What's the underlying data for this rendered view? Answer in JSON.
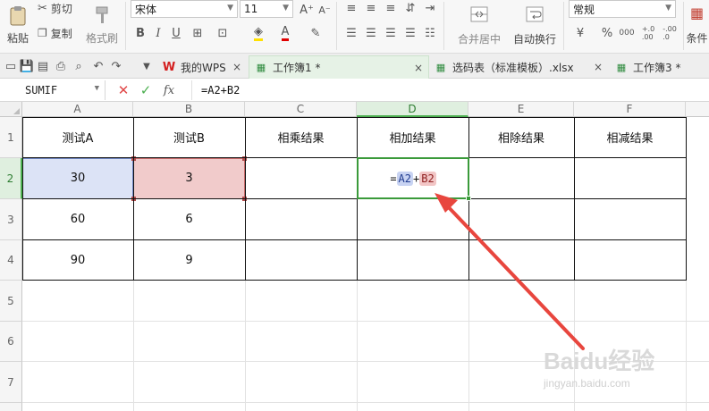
{
  "ribbon": {
    "paste_label": "粘贴",
    "cut_label": "剪切",
    "copy_label": "复制",
    "format_painter_label": "格式刷",
    "font_name": "宋体",
    "font_size": "11",
    "merge_center_label": "合并居中",
    "wrap_text_label": "自动换行",
    "number_format": "常规",
    "conditional_label": "条件",
    "bold": "B",
    "italic": "I",
    "underline": "U",
    "font_color_letter": "A",
    "increase_font": "A⁺",
    "decrease_font": "A⁻",
    "percent": "%",
    "thousands": "000",
    "inc_decimal": "+.0\n.00",
    "dec_decimal": "-.00\n.0"
  },
  "tabs": [
    {
      "label": "我的WPS",
      "icon": "wps-logo-icon"
    },
    {
      "label": "工作簿1 *",
      "icon": "spreadsheet-icon"
    },
    {
      "label": "选码表（标准模板）.xlsx",
      "icon": "spreadsheet-icon"
    },
    {
      "label": "工作簿3 *",
      "icon": "spreadsheet-icon"
    }
  ],
  "formula_bar": {
    "name_box": "SUMIF",
    "fx_label": "fx",
    "formula": "=A2+B2"
  },
  "grid": {
    "columns": [
      "A",
      "B",
      "C",
      "D",
      "E",
      "F"
    ],
    "rows": [
      "1",
      "2",
      "3",
      "4",
      "5",
      "6",
      "7"
    ],
    "header_row": [
      "测试A",
      "测试B",
      "相乘结果",
      "相加结果",
      "相除结果",
      "相减结果"
    ],
    "data": [
      [
        "30",
        "3"
      ],
      [
        "60",
        "6"
      ],
      [
        "90",
        "9"
      ]
    ],
    "edit_cell": {
      "eq": "=",
      "ref1": "A2",
      "plus": "+",
      "ref2": "B2"
    }
  },
  "colors": {
    "active_accent": "#3a9a3a",
    "ref_a2_fill": "#dce3f6",
    "ref_b2_fill": "#f1cbcb",
    "arrow": "#e8463e"
  },
  "watermark": {
    "brand": "Baidu经验",
    "url": "jingyan.baidu.com"
  }
}
